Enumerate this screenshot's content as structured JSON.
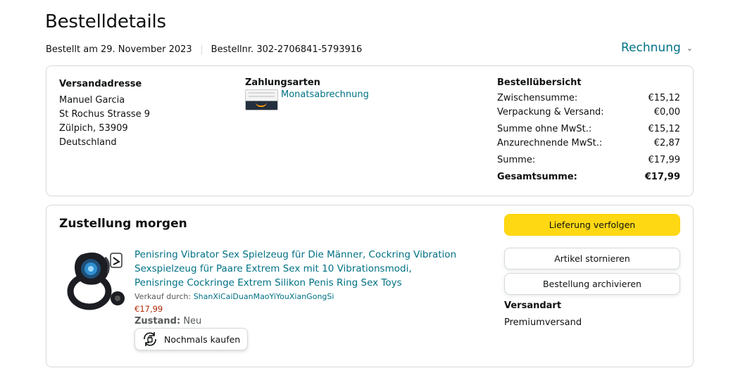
{
  "page": {
    "title": "Bestelldetails",
    "ordered_on": "Bestellt am 29. November 2023",
    "order_number": "Bestellnr. 302-2706841-5793916",
    "invoice_label": "Rechnung"
  },
  "address": {
    "label": "Versandadresse",
    "lines": [
      "Manuel Garcia",
      "St Rochus Strasse 9",
      "Zülpich, 53909",
      "Deutschland"
    ]
  },
  "payment": {
    "label": "Zahlungsarten",
    "method": "Monatsabrechnung"
  },
  "summary": {
    "label": "Bestellübersicht",
    "rows": [
      {
        "label": "Zwischensumme:",
        "value": "€15,12"
      },
      {
        "label": "Verpackung & Versand:",
        "value": "€0,00"
      },
      {
        "label": "Summe ohne MwSt.:",
        "value": "€15,12"
      },
      {
        "label": "Anzurechnende MwSt.:",
        "value": "€2,87"
      },
      {
        "label": "Summe:",
        "value": "€17,99"
      },
      {
        "label": "Gesamtsumme:",
        "value": "€17,99"
      }
    ]
  },
  "delivery": {
    "title": "Zustellung morgen",
    "product": {
      "title": "Penisring Vibrator Sex Spielzeug für Die Männer, Cockring Vibration Sexspielzeug für Paare Extrem Sex mit 10 Vibrationsmodi, Penisringe Cockringe Extrem Silikon Penis Ring Sex Toys",
      "seller_prefix": "Verkauf durch:",
      "seller_name": "ShanXiCaiDuanMaoYiYouXianGongSi",
      "price": "€17,99",
      "condition_label": "Zustand:",
      "condition_value": "Neu",
      "buy_again": "Nochmals kaufen"
    },
    "buttons": {
      "track": "Lieferung verfolgen",
      "cancel": "Artikel stornieren",
      "archive": "Bestellung archivieren"
    },
    "shipping_label": "Versandart",
    "shipping_value": "Premiumversand"
  },
  "colors": {
    "link": "#007185",
    "price": "#b12704",
    "primary_button": "#ffd814",
    "border": "#d5d9d9"
  }
}
